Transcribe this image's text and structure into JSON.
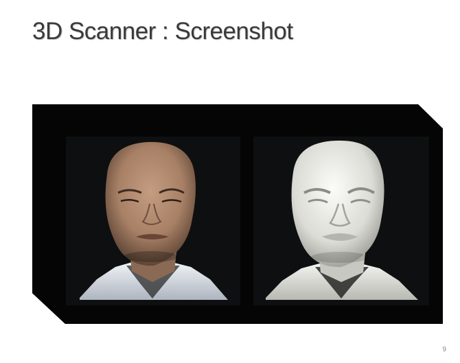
{
  "slide": {
    "title": "3D Scanner : Screenshot",
    "page_number": "9"
  },
  "figure": {
    "left_panel": "textured-face-scan",
    "right_panel": "untextured-mesh-face-scan",
    "colors": {
      "frame": "#ffffff",
      "background": "#050505",
      "skin": "#b08a6e",
      "mesh": "#e4e4e0",
      "shirt": "#d9dde4"
    }
  }
}
